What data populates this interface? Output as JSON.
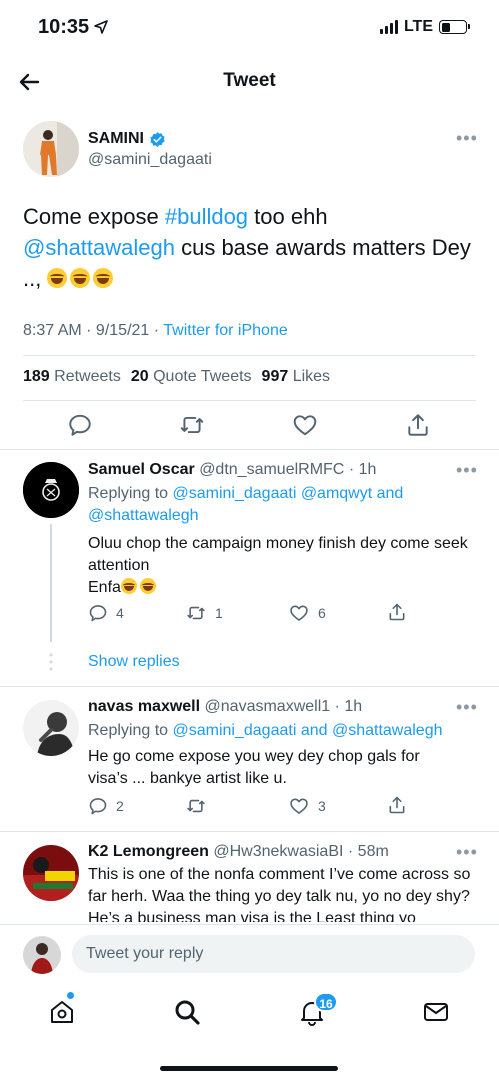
{
  "status_bar": {
    "time": "10:35",
    "network": "LTE"
  },
  "header": {
    "title": "Tweet"
  },
  "tweet": {
    "author_name": "SAMINI",
    "author_handle": "@samini_dagaati",
    "text_before_tag": "Come expose ",
    "hashtag": "#bulldog",
    "text_after_tag": " too ehh",
    "mention": "@shattawalegh",
    "text_after_mention": " cus base awards matters Dey ..,",
    "time": "8:37 AM",
    "date": "9/15/21",
    "source": "Twitter for iPhone",
    "retweets": "189",
    "retweets_label": "Retweets",
    "quotes": "20",
    "quotes_label": "Quote Tweets",
    "likes": "997",
    "likes_label": "Likes"
  },
  "replies": [
    {
      "name": "Samuel Oscar",
      "handle": "@dtn_samuelRMFC",
      "age": "· 1h",
      "replying_prefix": "Replying to ",
      "replying_to_1": "@samini_dagaati @amqwyt",
      "replying_and": " and",
      "replying_to_2": "@shattawalegh",
      "text_line1": "Oluu chop the campaign money finish dey come seek attention",
      "text_line2": "Enfa",
      "replies_count": "4",
      "retweets_count": "1",
      "likes_count": "6",
      "show_replies": "Show replies"
    },
    {
      "name": "navas maxwell",
      "handle": "@navasmaxwell1",
      "age": "· 1h",
      "replying_prefix": "Replying to ",
      "replying_to": "@samini_dagaati and @shattawalegh",
      "text": "He go come expose you wey dey chop gals for visa’s ... bankye artist like u.",
      "replies_count": "2",
      "likes_count": "3"
    },
    {
      "name": "K2 Lemongreen",
      "handle": "@Hw3nekwasiaBI",
      "age": "· 58m",
      "text": "This is one of the nonfa comment I’ve come across so far herh. Waa the thing yo dey talk nu, yo no dey shy? He’s a business man visa is the Least thing yo"
    }
  ],
  "reply_bar": {
    "placeholder": "Tweet your reply"
  },
  "tab_bar": {
    "notifications_badge": "16"
  },
  "colors": {
    "accent": "#1d9bf0",
    "text": "#0f1419",
    "secondary": "#536471"
  }
}
